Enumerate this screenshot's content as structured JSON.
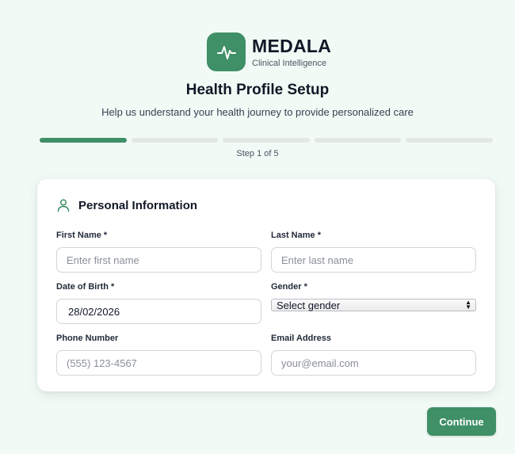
{
  "brand": {
    "name": "MEDALA",
    "tagline": "Clinical Intelligence",
    "logo_icon": "pulse-icon",
    "color": "#3f8f67"
  },
  "header": {
    "title": "Health Profile Setup",
    "subtitle": "Help us understand your health journey to provide personalized care"
  },
  "progress": {
    "current_step": 1,
    "total_steps": 5,
    "label": "Step 1 of 5"
  },
  "section": {
    "icon": "person-icon",
    "title": "Personal Information"
  },
  "fields": {
    "first_name": {
      "label": "First Name *",
      "placeholder": "Enter first name",
      "value": ""
    },
    "last_name": {
      "label": "Last Name *",
      "placeholder": "Enter last name",
      "value": ""
    },
    "dob": {
      "label": "Date of Birth *",
      "value": "28/02/2026"
    },
    "gender": {
      "label": "Gender *",
      "selected": "Select gender"
    },
    "phone": {
      "label": "Phone Number",
      "placeholder": "(555) 123-4567",
      "value": ""
    },
    "email": {
      "label": "Email Address",
      "placeholder": "your@email.com",
      "value": ""
    }
  },
  "actions": {
    "continue_label": "Continue"
  }
}
